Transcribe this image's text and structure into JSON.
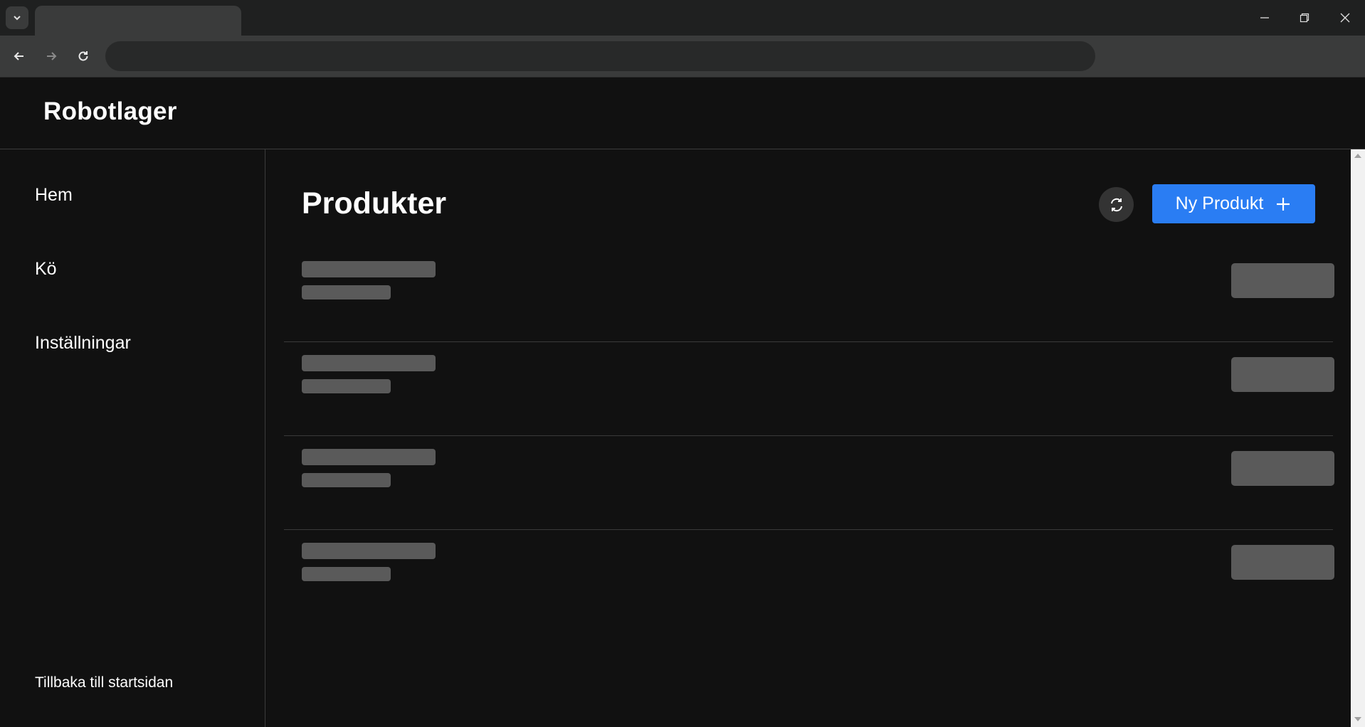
{
  "browser": {
    "tab_title": "",
    "address": ""
  },
  "app": {
    "title": "Robotlager"
  },
  "sidebar": {
    "items": [
      {
        "label": "Hem"
      },
      {
        "label": "Kö"
      },
      {
        "label": "Inställningar"
      }
    ],
    "back_link": "Tillbaka till startsidan"
  },
  "main": {
    "title": "Produkter",
    "new_button_label": "Ny Produkt",
    "rows_loading": 4
  },
  "colors": {
    "background": "#111111",
    "accent": "#2a7df3",
    "skeleton": "#5a5a5a"
  },
  "icons": {
    "refresh": "refresh-icon",
    "plus": "plus-icon"
  }
}
